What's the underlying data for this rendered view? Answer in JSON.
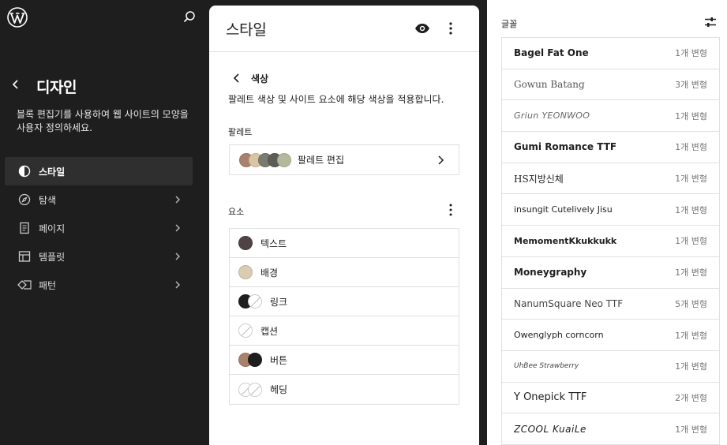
{
  "sidebar": {
    "title": "디자인",
    "description": "블록 편집기를 사용하여 웹 사이트의 모양을 사용자 정의하세요.",
    "items": [
      {
        "label": "스타일",
        "icon": "half-circle-icon",
        "active": true
      },
      {
        "label": "탐색",
        "icon": "compass-icon",
        "active": false
      },
      {
        "label": "페이지",
        "icon": "page-icon",
        "active": false
      },
      {
        "label": "템플릿",
        "icon": "layout-icon",
        "active": false
      },
      {
        "label": "패턴",
        "icon": "diamond-icon",
        "active": false
      }
    ]
  },
  "panel": {
    "title": "스타일",
    "crumb": "색상",
    "description": "팔레트 색상 및 사이트 요소에 해당 색상을 적용합니다.",
    "palette_label": "팔레트",
    "palette_edit": "팔레트 편집",
    "palette_colors": [
      "#a9826d",
      "#d6c6a6",
      "#7a7b6d",
      "#5c5e56",
      "#b4b89c"
    ],
    "elements_label": "요소",
    "elements": [
      {
        "label": "텍스트",
        "colors": [
          "#4f4345"
        ]
      },
      {
        "label": "배경",
        "colors": [
          "#d9ccb0"
        ]
      },
      {
        "label": "링크",
        "colors": [
          "#1e1e1e",
          ""
        ]
      },
      {
        "label": "캡션",
        "colors": [
          ""
        ]
      },
      {
        "label": "버튼",
        "colors": [
          "#a9826d",
          "#1e1e1e"
        ]
      },
      {
        "label": "헤딩",
        "colors": [
          "",
          ""
        ]
      }
    ]
  },
  "fonts": {
    "label": "글꼴",
    "items": [
      {
        "name": "Bagel Fat One",
        "variants": "1개 변형",
        "weight": "bold"
      },
      {
        "name": "Gowun Batang",
        "variants": "3개 변형",
        "weight": "normal"
      },
      {
        "name": "Griun YEONWOO",
        "variants": "1개 변형",
        "weight": "normal"
      },
      {
        "name": "Gumi Romance TTF",
        "variants": "1개 변형",
        "weight": "bold"
      },
      {
        "name": "HS지방신체",
        "variants": "1개 변형",
        "weight": "normal"
      },
      {
        "name": "insungit Cutelively Jisu",
        "variants": "1개 변형",
        "weight": "normal"
      },
      {
        "name": "MemomentKkukkukk",
        "variants": "1개 변형",
        "weight": "bold"
      },
      {
        "name": "Moneygraphy",
        "variants": "1개 변형",
        "weight": "bold"
      },
      {
        "name": "NanumSquare Neo TTF",
        "variants": "5개 변형",
        "weight": "normal"
      },
      {
        "name": "Owenglyph corncorn",
        "variants": "1개 변형",
        "weight": "normal"
      },
      {
        "name": "UhBee Strawberry",
        "variants": "1개 변형",
        "weight": "normal"
      },
      {
        "name": "Y Onepick TTF",
        "variants": "2개 변형",
        "weight": "normal"
      },
      {
        "name": "ZCOOL KuaiLe",
        "variants": "1개 변형",
        "weight": "normal"
      }
    ]
  },
  "colors": {
    "dark_bg": "#1e1e1e",
    "active_item_bg": "#2f2f2f",
    "border": "#e0e0e0",
    "muted_text": "#757575"
  }
}
